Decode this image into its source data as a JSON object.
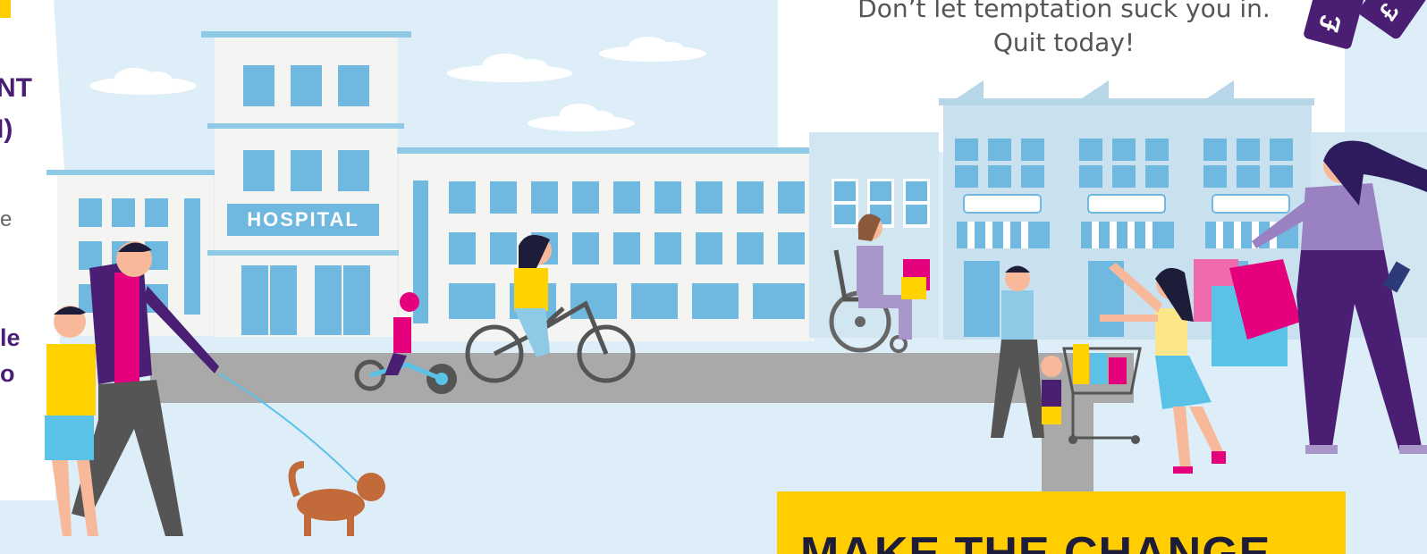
{
  "left_panel": {
    "fragment_1": "NT",
    "fragment_2": "I)",
    "fragment_3": "e",
    "fragment_4": "le",
    "fragment_5": "o"
  },
  "message": {
    "line_1": "Don’t let temptation suck you in.",
    "line_2": "Quit today!"
  },
  "hospital_sign": "HOSPITAL",
  "cta": {
    "label": "MAKE THE CHANGE"
  },
  "tags": {
    "pound_1": "£",
    "pound_2": "£"
  },
  "colors": {
    "sky": "#ddeef9",
    "road": "#a9a9a9",
    "building_light": "#f4f4f2",
    "window_blue": "#6fb9e0",
    "brand_purple": "#4a1f73",
    "cta_yellow": "#ffcd00",
    "pink": "#e5007e"
  }
}
